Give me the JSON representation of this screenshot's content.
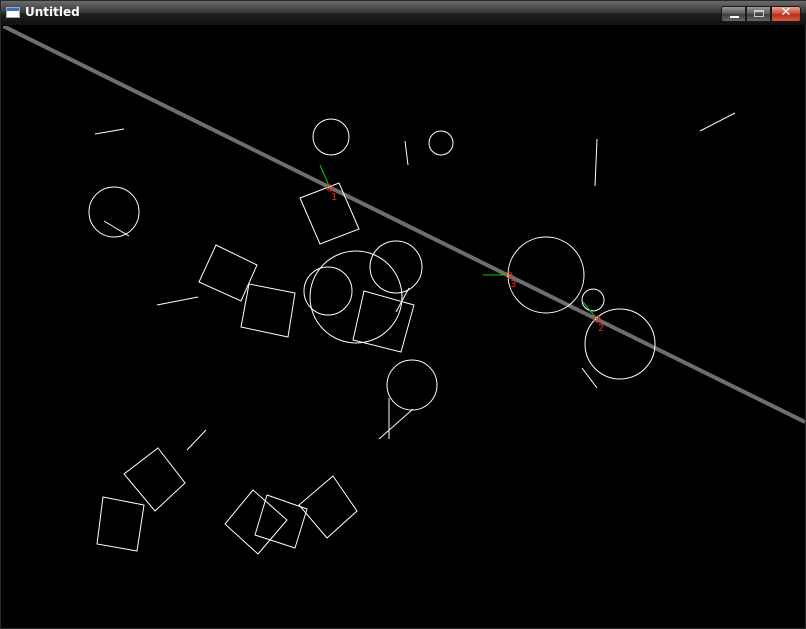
{
  "window": {
    "title": "Untitled",
    "icon": "window-app-icon",
    "controls": {
      "minimize_icon": "minimize-icon",
      "maximize_icon": "maximize-icon",
      "close_icon": "close-icon",
      "close_glyph": "✕"
    }
  },
  "scene": {
    "background": "#000000",
    "shape_color": "#ffffff",
    "ground_color": "#6e6e6e",
    "contact_color": "#ff2020",
    "normal_color": "#00cc00",
    "contact_labels": [
      "1",
      "3",
      "2"
    ]
  }
}
